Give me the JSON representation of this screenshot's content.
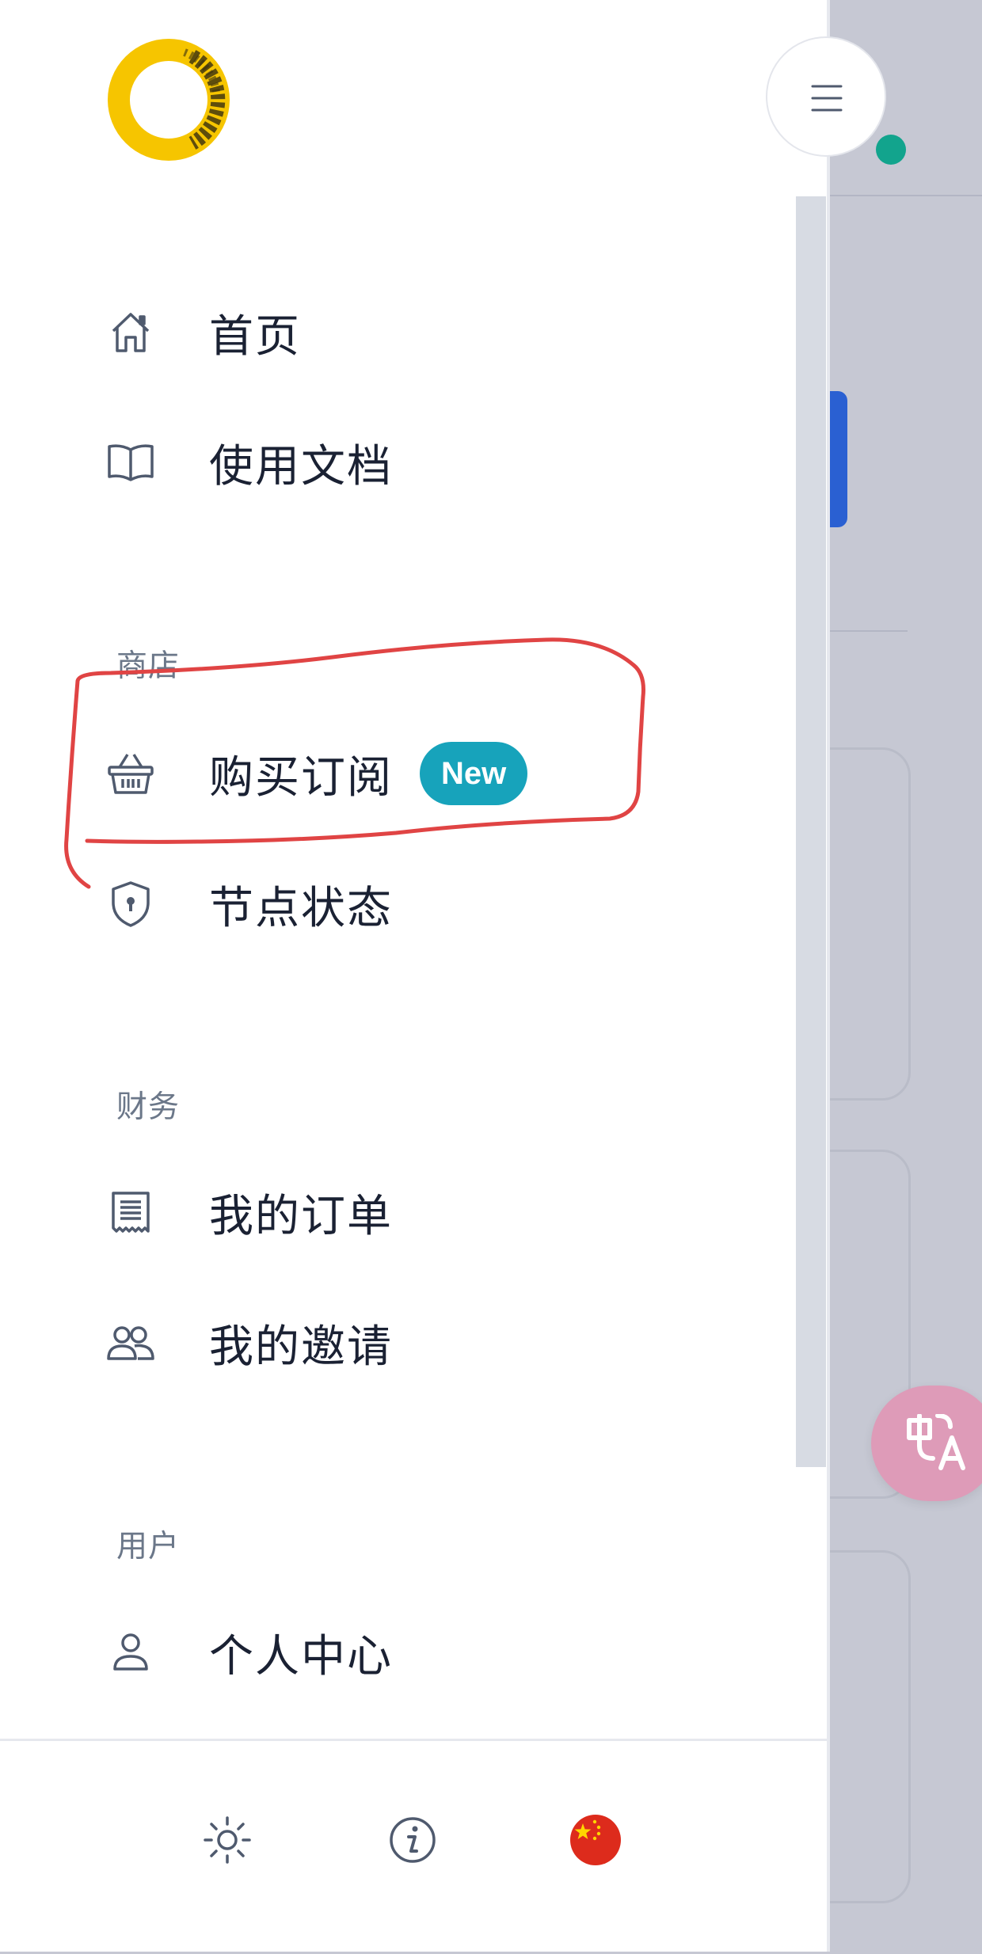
{
  "nav": {
    "items_top": [
      {
        "label": "首页",
        "icon": "home-icon"
      },
      {
        "label": "使用文档",
        "icon": "book-icon"
      }
    ],
    "sections": [
      {
        "title": "商店",
        "items": [
          {
            "label": "购买订阅",
            "icon": "basket-icon",
            "badge": "New"
          },
          {
            "label": "节点状态",
            "icon": "shield-icon"
          }
        ]
      },
      {
        "title": "财务",
        "items": [
          {
            "label": "我的订单",
            "icon": "receipt-icon"
          },
          {
            "label": "我的邀请",
            "icon": "users-icon"
          }
        ]
      },
      {
        "title": "用户",
        "items": [
          {
            "label": "个人中心",
            "icon": "user-icon"
          }
        ]
      }
    ]
  },
  "footer": {
    "buttons": [
      "sun-icon",
      "info-icon",
      "china-flag-icon"
    ]
  },
  "colors": {
    "badge": "#17a3bb",
    "online_dot": "#12a48d",
    "annotation": "#e04444",
    "translate_button": "#de9bb8",
    "logo": "#f6c500"
  }
}
